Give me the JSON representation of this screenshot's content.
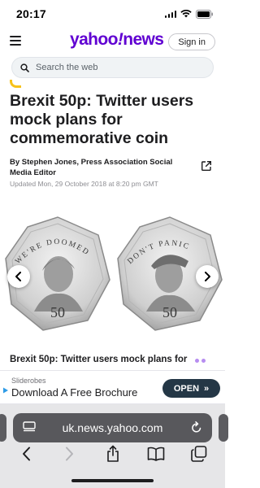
{
  "status_bar": {
    "time": "20:17"
  },
  "header": {
    "logo_main": "yahoo",
    "logo_sep": "!",
    "logo_section": "news",
    "signin_label": "Sign in"
  },
  "search": {
    "placeholder": "Search the web"
  },
  "article": {
    "title": "Brexit 50p: Twitter users mock plans for commemorative coin",
    "byline": "By Stephen Jones, Press Association Social Media Editor",
    "dateline": "Updated Mon, 29 October 2018 at 8:20 pm GMT"
  },
  "image": {
    "coin_left_text": "WE'RE DOOMED",
    "coin_right_text": "DON'T PANIC",
    "coin_value": "50",
    "caption": "Brexit 50p: Twitter users mock plans for"
  },
  "ad": {
    "advertiser": "Sliderobes",
    "headline": "Download A Free Brochure",
    "cta": "OPEN",
    "cta_icon": "»"
  },
  "browser": {
    "url": "uk.news.yahoo.com"
  },
  "colors": {
    "brand_purple": "#6001d2",
    "ad_button": "#243746",
    "url_bar": "#58585c"
  }
}
